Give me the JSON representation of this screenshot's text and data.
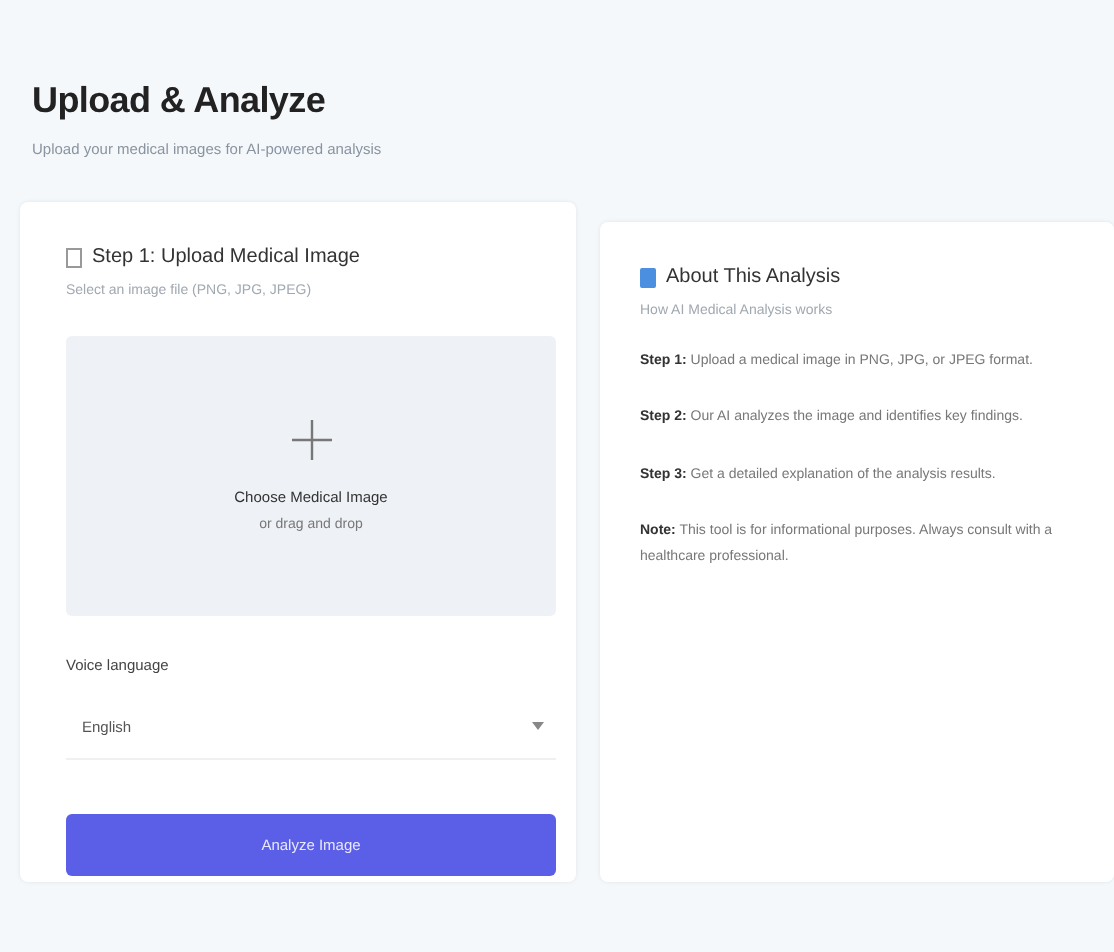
{
  "header": {
    "title": "Upload & Analyze",
    "subtitle": "Upload your medical images for AI-powered analysis"
  },
  "upload_card": {
    "title": "Step 1: Upload Medical Image",
    "hint": "Select an image file (PNG, JPG, JPEG)",
    "dropzone": {
      "label": "Choose Medical Image",
      "sublabel": "or drag and drop"
    },
    "language_label": "Voice language",
    "language_value": "English",
    "button": "Analyze Image"
  },
  "about_card": {
    "title": "About This Analysis",
    "subtitle": "How AI Medical Analysis works",
    "steps": [
      "**Step 1:** Upload a medical image in PNG, JPG, or JPEG format.",
      "**Step 2:** Our AI analyzes the image and identifies key findings.",
      "**Step 3:** Get a detailed explanation of the analysis results.",
      "**Note:** This tool is for informational purposes. Always consult with a healthcare professional."
    ]
  }
}
